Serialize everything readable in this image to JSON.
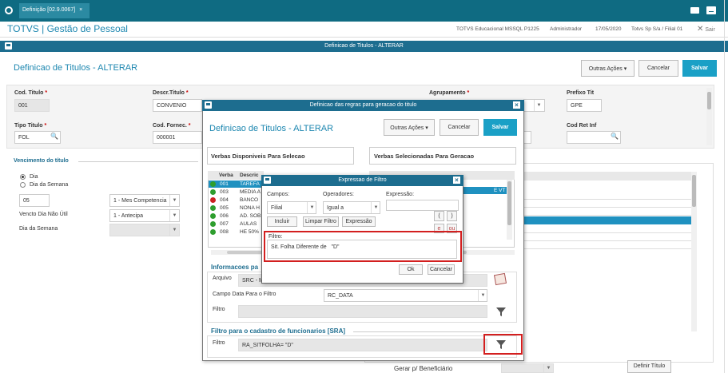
{
  "topbar": {
    "tab_label": "Definição [02.9.0067]",
    "close_glyph": "×"
  },
  "app": {
    "title": "TOTVS | Gestão de Pessoal",
    "environment": "TOTVS Educacional MSSQL P1225",
    "user": "Administrador",
    "date": "17/05/2020",
    "company": "Totvs Sp S/a / Filial 01",
    "exit_label": "Sair"
  },
  "main_window": {
    "title": "Definicao de Titulos - ALTERAR",
    "heading": "Definicao de Titulos - ALTERAR",
    "actions_label": "Outras Ações",
    "cancel_label": "Cancelar",
    "save_label": "Salvar"
  },
  "form": {
    "cod_titulo_label": "Cod. Titulo",
    "cod_titulo_value": "001",
    "descr_titulo_label": "Descr.Titulo",
    "descr_titulo_value": "CONVENIO",
    "agrupamento_label": "Agrupamento",
    "prefixo_label": "Prefixo Tit",
    "prefixo_value": "GPE",
    "tipo_label": "Tipo Titulo",
    "tipo_value": "FOL",
    "fornec_label": "Cod. Fornec.",
    "fornec_value": "000001",
    "cod_ret_label": "Cod Ret Inf",
    "required_mark": "*"
  },
  "vencimento": {
    "heading": "Vencimento do título",
    "opt_dia": "Dia",
    "opt_dia_semana": "Dia da Semana",
    "dia_value": "05",
    "competencia_value": "1 - Mes Competencia",
    "vencto_label": "Vencto Dia Não Útil",
    "vencto_value": "1 - Antecipa",
    "dia_semana_label": "Dia da Semana"
  },
  "bottom": {
    "gerar_label": "Gerar p/ Beneficiário",
    "definir_label": "Definir Título"
  },
  "rules_window": {
    "title": "Definicao das regras para geracao do titulo",
    "heading": "Definicao de Titulos - ALTERAR",
    "actions_label": "Outras Ações",
    "cancel_label": "Cancelar",
    "save_label": "Salvar",
    "disponiveis_label": "Verbas Disponiveis Para Selecao",
    "selecionadas_label": "Verbas Selecionadas Para Geracao",
    "col_verba": "Verba",
    "col_descr": "Descric",
    "verbas": [
      {
        "code": "001",
        "descr": "TAREFA",
        "status": "ok"
      },
      {
        "code": "003",
        "descr": "MEDIA A",
        "status": "ok"
      },
      {
        "code": "004",
        "descr": "BANCO",
        "status": "err"
      },
      {
        "code": "005",
        "descr": "NONA H",
        "status": "ok"
      },
      {
        "code": "006",
        "descr": "AD. SOB",
        "status": "ok"
      },
      {
        "code": "007",
        "descr": "AULAS",
        "status": "ok"
      },
      {
        "code": "008",
        "descr": "HE 50%",
        "status": "ok"
      }
    ],
    "selected_fragment": "E VT",
    "info_heading": "Informacoes pa",
    "arquivo_label": "Arquivo",
    "arquivo_value": "SRC - M",
    "campo_data_label": "Campo Data Para o Filtro",
    "campo_data_value": "RC_DATA",
    "filtro_label": "Filtro",
    "sra_heading": "Filtro para o cadastro de funcionarios [SRA]",
    "sra_filtro_label": "Filtro",
    "sra_filtro_value": "RA_SITFOLHA= \"D\""
  },
  "filter_dialog": {
    "title": "Expressao de Filtro",
    "campos_label": "Campos:",
    "campos_value": "Filial",
    "operadores_label": "Operadores:",
    "operadores_value": "Igual a",
    "expressao_label": "Expressão:",
    "incluir_label": "Incluir",
    "limpar_label": "Limpar Filtro",
    "expressao_btn_label": "Expressão",
    "paren_open": "(",
    "paren_close": ")",
    "e_label": "e",
    "ou_label": "ou",
    "filtro_label": "Filtro:",
    "filtro_value": "Sit. Folha Diferente de   \"D\"",
    "ok_label": "Ok",
    "cancel_label": "Cancelar"
  }
}
